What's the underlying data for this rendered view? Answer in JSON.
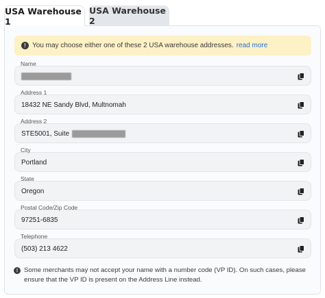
{
  "tabs": [
    {
      "label": "USA Warehouse 1",
      "active": true
    },
    {
      "label": "USA Warehouse 2",
      "active": false
    }
  ],
  "notice": {
    "text": "You may choose either one of these 2 USA warehouse addresses.",
    "link": "read more"
  },
  "fields": {
    "name": {
      "label": "Name",
      "value": ""
    },
    "address1": {
      "label": "Address 1",
      "value": "18432 NE Sandy Blvd, Multnomah"
    },
    "address2": {
      "label": "Address 2",
      "value": "STE5001, Suite"
    },
    "city": {
      "label": "City",
      "value": "Portland"
    },
    "state": {
      "label": "State",
      "value": "Oregon"
    },
    "postal": {
      "label": "Postal Code/Zip Code",
      "value": "97251-6835"
    },
    "telephone": {
      "label": "Telephone",
      "value": "(503) 213 4622"
    }
  },
  "footnote": "Some merchants may not accept your name with a number code (VP ID). On such cases, please ensure that the VP ID is present on the Address Line instead.",
  "icons": {
    "copy": "copy-icon",
    "info": "info-icon"
  }
}
